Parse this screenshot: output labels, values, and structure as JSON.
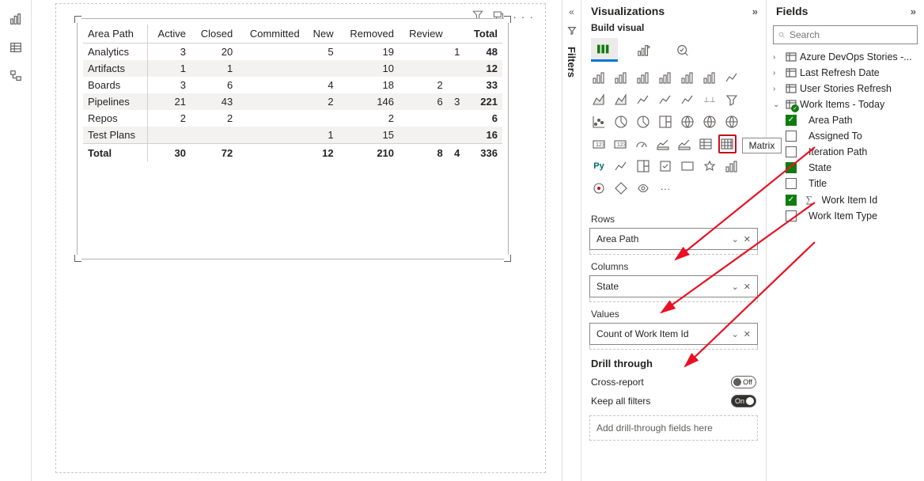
{
  "panes": {
    "visualizations": "Visualizations",
    "build_visual": "Build visual",
    "fields": "Fields",
    "filters": "Filters"
  },
  "search": {
    "placeholder": "Search"
  },
  "table": {
    "headers": [
      "Area Path",
      "Active",
      "Closed",
      "Committed",
      "New",
      "Removed",
      "Review",
      "Total"
    ],
    "rows": [
      {
        "c": [
          "Analytics",
          "3",
          "20",
          "",
          "5",
          "19",
          "",
          "1",
          "48"
        ]
      },
      {
        "c": [
          "Artifacts",
          "1",
          "1",
          "",
          "",
          "10",
          "",
          "",
          "12"
        ]
      },
      {
        "c": [
          "Boards",
          "3",
          "6",
          "",
          "4",
          "18",
          "2",
          "",
          "33"
        ]
      },
      {
        "c": [
          "Pipelines",
          "21",
          "43",
          "",
          "2",
          "146",
          "6",
          "3",
          "221"
        ]
      },
      {
        "c": [
          "Repos",
          "2",
          "2",
          "",
          "",
          "2",
          "",
          "",
          "6"
        ]
      },
      {
        "c": [
          "Test Plans",
          "",
          "",
          "",
          "1",
          "15",
          "",
          "",
          "16"
        ]
      }
    ],
    "footer": [
      "Total",
      "30",
      "72",
      "",
      "12",
      "210",
      "8",
      "4",
      "336"
    ]
  },
  "wells": {
    "rows_label": "Rows",
    "rows_value": "Area Path",
    "cols_label": "Columns",
    "cols_value": "State",
    "vals_label": "Values",
    "vals_value": "Count of Work Item Id"
  },
  "drill": {
    "title": "Drill through",
    "cross": "Cross-report",
    "keep": "Keep all filters",
    "off": "Off",
    "on": "On",
    "drop": "Add drill-through fields here"
  },
  "matrix_tooltip": "Matrix",
  "fields_tree": {
    "t0": "Azure DevOps Stories -...",
    "t1": "Last Refresh Date",
    "t2": "User Stories Refresh",
    "t3": "Work Items - Today",
    "c0": "Area Path",
    "c1": "Assigned To",
    "c2": "Iteration Path",
    "c3": "State",
    "c4": "Title",
    "c5": "Work Item Id",
    "c6": "Work Item Type"
  }
}
